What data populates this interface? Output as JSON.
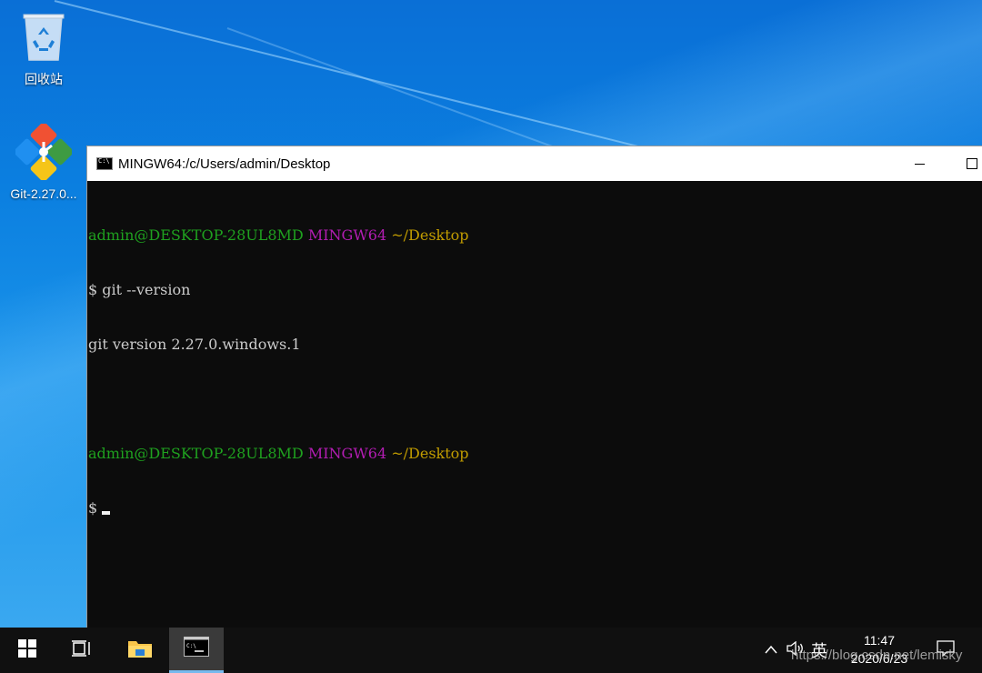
{
  "desktop": {
    "icons": [
      {
        "label": "回收站",
        "icon": "recycle-bin-icon"
      },
      {
        "label": "Git-2.27.0...",
        "icon": "git-installer-icon"
      }
    ]
  },
  "window": {
    "title": "MINGW64:/c/Users/admin/Desktop",
    "icon": "console-icon",
    "terminal": {
      "lines": [
        {
          "user": "admin@DESKTOP-28UL8MD",
          "env": "MINGW64",
          "path": "~/Desktop"
        },
        {
          "text": "$ git --version"
        },
        {
          "text": "git version 2.27.0.windows.1"
        },
        {
          "text": ""
        },
        {
          "user": "admin@DESKTOP-28UL8MD",
          "env": "MINGW64",
          "path": "~/Desktop"
        },
        {
          "text": "$ "
        }
      ],
      "prompt_line_1": {
        "user": "admin@DESKTOP-28UL8MD",
        "env": "MINGW64",
        "path": "~/Desktop"
      },
      "command": "$ git --version",
      "output": "git version 2.27.0.windows.1",
      "prompt_line_2": {
        "user": "admin@DESKTOP-28UL8MD",
        "env": "MINGW64",
        "path": "~/Desktop"
      },
      "current_input": "$ "
    },
    "colors": {
      "user": "#1fa11f",
      "env": "#b21db2",
      "path": "#c19c00",
      "text": "#cccccc",
      "background": "#0c0c0c"
    }
  },
  "taskbar": {
    "tray": {
      "ime": "英",
      "time": "11:47",
      "date": "2020/6/23"
    },
    "watermark": "https://blog.csdn.net/lemisky"
  }
}
